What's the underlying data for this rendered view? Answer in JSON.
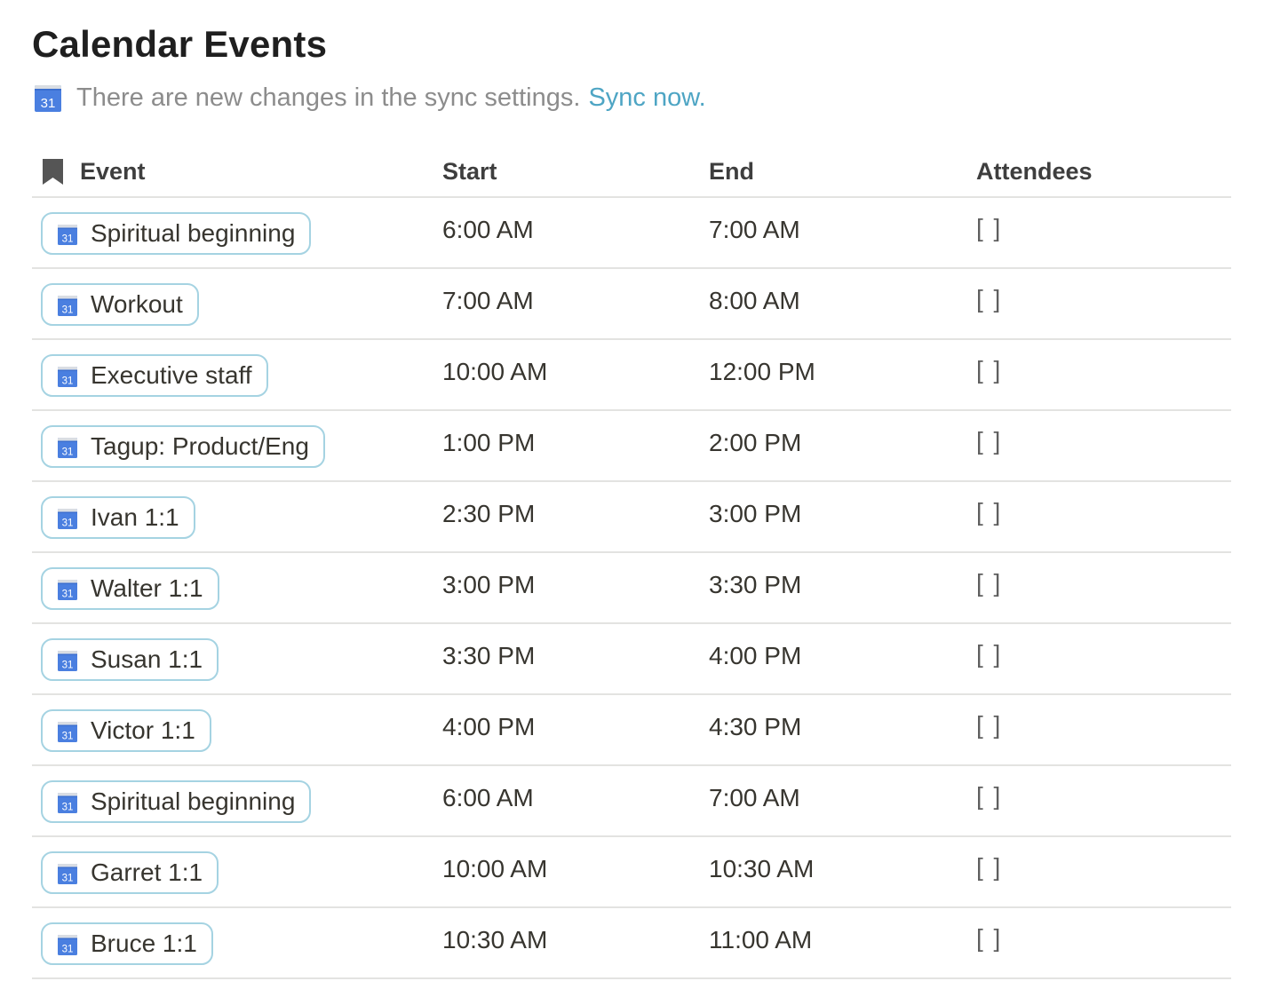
{
  "page": {
    "title": "Calendar Events"
  },
  "sync_notice": {
    "icon": "google-calendar-icon",
    "message": "There are new changes in the sync settings.",
    "link_label": "Sync now.",
    "link_color": "#4ea5c4"
  },
  "table": {
    "columns": {
      "event": "Event",
      "start": "Start",
      "end": "End",
      "attendees": "Attendees"
    },
    "event_column_icon": "bookmark-icon",
    "rows": [
      {
        "event": "Spiritual beginning",
        "start": "6:00 AM",
        "end": "7:00 AM",
        "attendees": "[ ]"
      },
      {
        "event": "Workout",
        "start": "7:00 AM",
        "end": "8:00 AM",
        "attendees": "[ ]"
      },
      {
        "event": "Executive staff",
        "start": "10:00 AM",
        "end": "12:00 PM",
        "attendees": "[ ]"
      },
      {
        "event": "Tagup: Product/Eng",
        "start": "1:00 PM",
        "end": "2:00 PM",
        "attendees": "[ ]"
      },
      {
        "event": "Ivan 1:1",
        "start": "2:30 PM",
        "end": "3:00 PM",
        "attendees": "[ ]"
      },
      {
        "event": "Walter 1:1",
        "start": "3:00 PM",
        "end": "3:30 PM",
        "attendees": "[ ]"
      },
      {
        "event": "Susan 1:1",
        "start": "3:30 PM",
        "end": "4:00 PM",
        "attendees": "[ ]"
      },
      {
        "event": "Victor 1:1",
        "start": "4:00 PM",
        "end": "4:30 PM",
        "attendees": "[ ]"
      },
      {
        "event": "Spiritual beginning",
        "start": "6:00 AM",
        "end": "7:00 AM",
        "attendees": "[ ]"
      },
      {
        "event": "Garret 1:1",
        "start": "10:00 AM",
        "end": "10:30 AM",
        "attendees": "[ ]"
      },
      {
        "event": "Bruce 1:1",
        "start": "10:30 AM",
        "end": "11:00 AM",
        "attendees": "[ ]"
      }
    ]
  },
  "colors": {
    "pill_border": "#a5d3e2",
    "calendar_blue": "#4a7fe0",
    "row_divider": "#e3e3e1"
  }
}
